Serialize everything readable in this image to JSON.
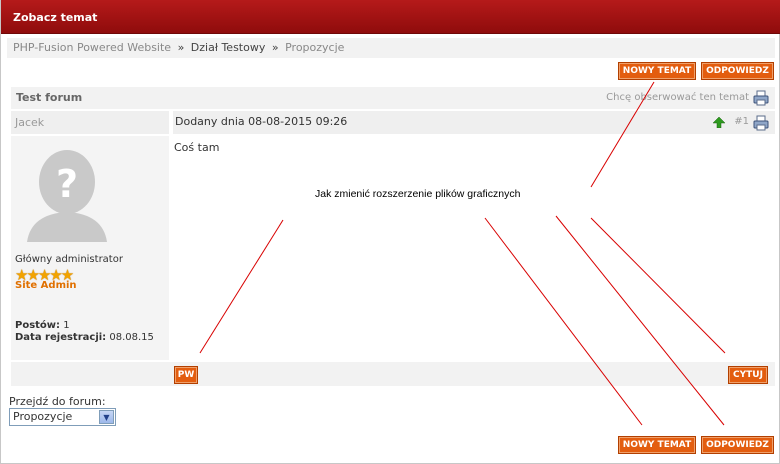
{
  "header": {
    "title": "Zobacz temat"
  },
  "breadcrumb": {
    "site": "PHP-Fusion Powered Website",
    "sep": "»",
    "section": "Dział Testowy",
    "forum": "Propozycje"
  },
  "actions": {
    "new_topic": "NOWY TEMAT",
    "reply": "ODPOWIEDZ"
  },
  "forum": {
    "name": "Test forum",
    "watch_text": "Chcę obserwować ten temat"
  },
  "post": {
    "author": "Jacek",
    "date": "Dodany dnia 08-08-2015 09:26",
    "number": "#1",
    "content": "Coś tam",
    "rank": "Główny administrator",
    "role": "Site Admin",
    "posts_label": "Postów:",
    "posts_value": "1",
    "joined_label": "Data rejestracji:",
    "joined_value": "08.08.15",
    "stars": "★★★★★",
    "pm": "PW",
    "quote": "CYTUJ"
  },
  "jump": {
    "label": "Przejdź do forum:",
    "selected": "Propozycje"
  },
  "annotation": {
    "text": "Jak zmienić rozszerzenie plików graficznych"
  },
  "colors": {
    "header": "#9c0f0f",
    "button": "#e35d0f",
    "accent_text": "#e07000"
  },
  "icons": [
    "printer-icon",
    "arrow-up-icon",
    "chevron-down-icon",
    "avatar-placeholder-icon"
  ]
}
